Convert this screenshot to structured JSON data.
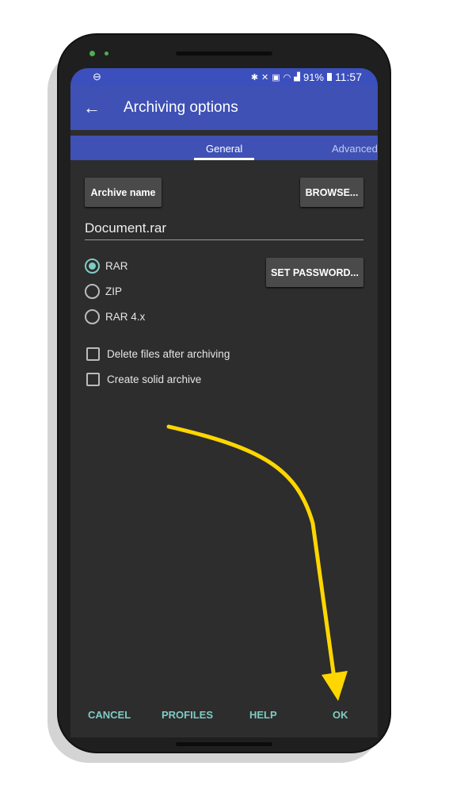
{
  "status_bar": {
    "time": "11:57",
    "battery": "91%",
    "icons": [
      "do-not-disturb-icon",
      "bluetooth-icon",
      "mute-icon",
      "battery-saver-icon",
      "wifi-icon",
      "signal-icon",
      "battery-icon"
    ]
  },
  "toolbar": {
    "title": "Archiving options"
  },
  "tabs": [
    {
      "label": "General",
      "active": true
    },
    {
      "label": "Advanced",
      "active": false
    }
  ],
  "buttons": {
    "archive_name": "Archive name",
    "browse": "BROWSE...",
    "set_password": "SET PASSWORD..."
  },
  "archive_name_value": "Document.rar",
  "formats": [
    {
      "label": "RAR",
      "selected": true
    },
    {
      "label": "ZIP",
      "selected": false
    },
    {
      "label": "RAR 4.x",
      "selected": false
    }
  ],
  "options": [
    {
      "label": "Delete files after archiving",
      "checked": false
    },
    {
      "label": "Create solid archive",
      "checked": false
    }
  ],
  "footer": {
    "cancel": "CANCEL",
    "profiles": "PROFILES",
    "help": "HELP",
    "ok": "OK"
  },
  "colors": {
    "primary": "#3f51b5",
    "accent": "#80cbc4",
    "background": "#2d2d2d",
    "annotation_arrow": "#ffd600"
  }
}
